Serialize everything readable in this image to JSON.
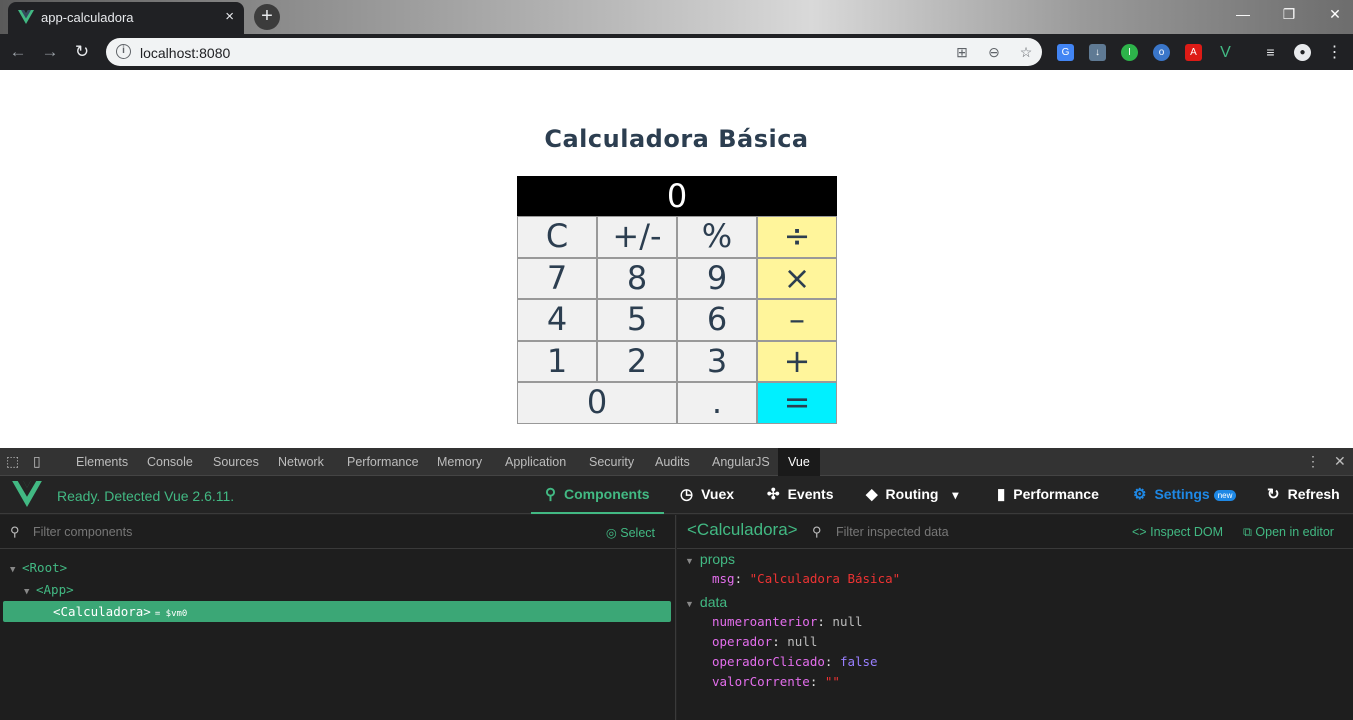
{
  "browser": {
    "tab_title": "app-calculadora",
    "tab_close": "×",
    "new_tab": "+",
    "url": "localhost:8080",
    "window_controls": {
      "minimize": "—",
      "restore": "❐",
      "close": "✕"
    }
  },
  "page": {
    "title": "Calculadora Básica",
    "display": "0",
    "keys": [
      {
        "label": "C",
        "type": "fn"
      },
      {
        "label": "+/-",
        "type": "fn"
      },
      {
        "label": "%",
        "type": "fn"
      },
      {
        "label": "÷",
        "type": "op"
      },
      {
        "label": "7",
        "type": "num"
      },
      {
        "label": "8",
        "type": "num"
      },
      {
        "label": "9",
        "type": "num"
      },
      {
        "label": "×",
        "type": "op"
      },
      {
        "label": "4",
        "type": "num"
      },
      {
        "label": "5",
        "type": "num"
      },
      {
        "label": "6",
        "type": "num"
      },
      {
        "label": "–",
        "type": "op"
      },
      {
        "label": "1",
        "type": "num"
      },
      {
        "label": "2",
        "type": "num"
      },
      {
        "label": "3",
        "type": "num"
      },
      {
        "label": "+",
        "type": "op"
      },
      {
        "label": "0",
        "type": "num",
        "span": 2
      },
      {
        "label": ".",
        "type": "num"
      },
      {
        "label": "=",
        "type": "eq"
      }
    ]
  },
  "devtools": {
    "tabs": [
      "Elements",
      "Console",
      "Sources",
      "Network",
      "Performance",
      "Memory",
      "Application",
      "Security",
      "Audits",
      "AngularJS",
      "Vue"
    ],
    "active_tab": "Vue",
    "vue": {
      "status": "Ready. Detected Vue 2.6.11.",
      "nav": {
        "components": "Components",
        "vuex": "Vuex",
        "events": "Events",
        "routing": "Routing",
        "performance": "Performance",
        "settings": "Settings",
        "settings_badge": "new",
        "refresh": "Refresh"
      },
      "filter_components_placeholder": "Filter components",
      "select_label": "Select",
      "tree": {
        "root": "<Root>",
        "app": "<App>",
        "selected": "<Calculadora>",
        "selected_ref": "= $vm0"
      },
      "inspected": {
        "component": "<Calculadora>",
        "filter_placeholder": "Filter inspected data",
        "inspect_dom": "Inspect DOM",
        "open_in_editor": "Open in editor",
        "props_label": "props",
        "props": [
          {
            "key": "msg",
            "value": "\"Calculadora Básica\""
          }
        ],
        "data_label": "data",
        "data": [
          {
            "key": "numeroanterior",
            "value": "null"
          },
          {
            "key": "operador",
            "value": "null"
          },
          {
            "key": "operadorClicado",
            "value": "false"
          },
          {
            "key": "valorCorrente",
            "value": "\"\""
          }
        ]
      }
    }
  },
  "colors": {
    "vue_green": "#42b983",
    "operator_key": "#fff59b",
    "equals_key": "#00f0ff",
    "display_bg": "#000000",
    "title_text": "#2c3e50"
  }
}
